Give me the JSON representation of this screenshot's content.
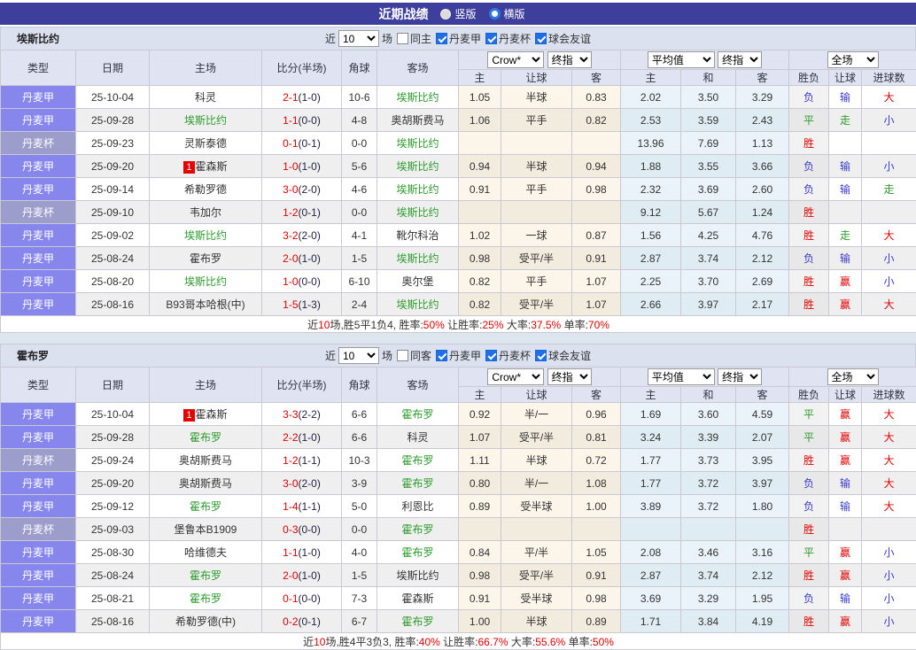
{
  "titlebar": {
    "title": "近期战绩",
    "vertical_label": "竖版",
    "horizontal_label": "横版",
    "vertical_checked": false,
    "horizontal_checked": true
  },
  "filters": {
    "near_label": "近",
    "count_value": "10",
    "matches_label": "场",
    "leagues": [
      "丹麦甲",
      "丹麦杯",
      "球会友谊"
    ]
  },
  "columns": {
    "type": "类型",
    "date": "日期",
    "home": "主场",
    "score": "比分(半场)",
    "corner": "角球",
    "away": "客场",
    "crow_select": "Crow*",
    "final_select": "终指",
    "avg_select": "平均值",
    "final2_select": "终指",
    "fulltime_select": "全场",
    "sub": {
      "home": "主",
      "handicap": "让球",
      "away": "客",
      "avg_home": "主",
      "draw": "和",
      "avg_away": "客",
      "wdl": "胜负",
      "hand_result": "让球",
      "goals": "进球数"
    }
  },
  "colors": {
    "topbar": "#3e3e9c",
    "league_cell": "#8686ec",
    "cup_cell": "#9d9dcb",
    "highlight_team": "#2d9b2d",
    "win_red": "#e00000",
    "lose_blue": "#3939cc",
    "draw_green": "#2d9b2d"
  },
  "result_colors": {
    "胜": "red",
    "平": "green",
    "负": "blue",
    "赢": "red",
    "走": "green",
    "输": "blue",
    "大": "red",
    "小": "blue"
  },
  "sections": [
    {
      "team": "埃斯比约",
      "same_label": "同主",
      "rows": [
        {
          "type": "丹麦甲",
          "cup": false,
          "date": "25-10-04",
          "home": "科灵",
          "home_hl": false,
          "score": "2-1",
          "half": "(1-0)",
          "corner": "10-6",
          "away": "埃斯比约",
          "away_hl": true,
          "crow": [
            "1.05",
            "半球",
            "0.83"
          ],
          "avg": [
            "2.02",
            "3.50",
            "3.29"
          ],
          "res": [
            "负",
            "输",
            "大"
          ]
        },
        {
          "type": "丹麦甲",
          "cup": false,
          "date": "25-09-28",
          "home": "埃斯比约",
          "home_hl": true,
          "score": "1-1",
          "half": "(0-0)",
          "corner": "4-8",
          "away": "奥胡斯费马",
          "away_hl": false,
          "crow": [
            "1.06",
            "平手",
            "0.82"
          ],
          "avg": [
            "2.53",
            "3.59",
            "2.43"
          ],
          "res": [
            "平",
            "走",
            "小"
          ]
        },
        {
          "type": "丹麦杯",
          "cup": true,
          "date": "25-09-23",
          "home": "灵斯泰德",
          "home_hl": false,
          "score": "0-1",
          "half": "(0-1)",
          "corner": "0-0",
          "away": "埃斯比约",
          "away_hl": true,
          "crow": [
            "",
            "",
            ""
          ],
          "avg": [
            "13.96",
            "7.69",
            "1.13"
          ],
          "res": [
            "胜",
            "",
            ""
          ]
        },
        {
          "type": "丹麦甲",
          "cup": false,
          "date": "25-09-20",
          "badge": "1",
          "home": "霍森斯",
          "home_hl": false,
          "score": "1-0",
          "half": "(1-0)",
          "corner": "5-6",
          "away": "埃斯比约",
          "away_hl": true,
          "crow": [
            "0.94",
            "半球",
            "0.94"
          ],
          "avg": [
            "1.88",
            "3.55",
            "3.66"
          ],
          "res": [
            "负",
            "输",
            "小"
          ]
        },
        {
          "type": "丹麦甲",
          "cup": false,
          "date": "25-09-14",
          "home": "希勒罗德",
          "home_hl": false,
          "score": "3-0",
          "half": "(2-0)",
          "corner": "4-6",
          "away": "埃斯比约",
          "away_hl": true,
          "crow": [
            "0.91",
            "平手",
            "0.98"
          ],
          "avg": [
            "2.32",
            "3.69",
            "2.60"
          ],
          "res": [
            "负",
            "输",
            "走"
          ]
        },
        {
          "type": "丹麦杯",
          "cup": true,
          "date": "25-09-10",
          "home": "韦加尔",
          "home_hl": false,
          "score": "1-2",
          "half": "(0-1)",
          "corner": "0-0",
          "away": "埃斯比约",
          "away_hl": true,
          "crow": [
            "",
            "",
            ""
          ],
          "avg": [
            "9.12",
            "5.67",
            "1.24"
          ],
          "res": [
            "胜",
            "",
            ""
          ]
        },
        {
          "type": "丹麦甲",
          "cup": false,
          "date": "25-09-02",
          "home": "埃斯比约",
          "home_hl": true,
          "score": "3-2",
          "half": "(2-0)",
          "corner": "4-1",
          "away": "靴尔科治",
          "away_hl": false,
          "crow": [
            "1.02",
            "一球",
            "0.87"
          ],
          "avg": [
            "1.56",
            "4.25",
            "4.76"
          ],
          "res": [
            "胜",
            "走",
            "大"
          ]
        },
        {
          "type": "丹麦甲",
          "cup": false,
          "date": "25-08-24",
          "home": "霍布罗",
          "home_hl": false,
          "score": "2-0",
          "half": "(1-0)",
          "corner": "1-5",
          "away": "埃斯比约",
          "away_hl": true,
          "crow": [
            "0.98",
            "受平/半",
            "0.91"
          ],
          "avg": [
            "2.87",
            "3.74",
            "2.12"
          ],
          "res": [
            "负",
            "输",
            "小"
          ]
        },
        {
          "type": "丹麦甲",
          "cup": false,
          "date": "25-08-20",
          "home": "埃斯比约",
          "home_hl": true,
          "score": "1-0",
          "half": "(0-0)",
          "corner": "6-10",
          "away": "奥尔堡",
          "away_hl": false,
          "crow": [
            "0.82",
            "平手",
            "1.07"
          ],
          "avg": [
            "2.25",
            "3.70",
            "2.69"
          ],
          "res": [
            "胜",
            "赢",
            "小"
          ]
        },
        {
          "type": "丹麦甲",
          "cup": false,
          "date": "25-08-16",
          "home": "B93哥本哈根(中)",
          "home_hl": false,
          "score": "1-5",
          "half": "(1-3)",
          "corner": "2-4",
          "away": "埃斯比约",
          "away_hl": true,
          "crow": [
            "0.82",
            "受平/半",
            "1.07"
          ],
          "avg": [
            "2.66",
            "3.97",
            "2.17"
          ],
          "res": [
            "胜",
            "赢",
            "大"
          ]
        }
      ],
      "summary": [
        {
          "t": "近"
        },
        {
          "t": "10",
          "red": true
        },
        {
          "t": "场,胜5平1负4, 胜率:"
        },
        {
          "t": "50%",
          "red": true
        },
        {
          "t": " 让胜率:"
        },
        {
          "t": "25%",
          "red": true
        },
        {
          "t": " 大率:"
        },
        {
          "t": "37.5%",
          "red": true
        },
        {
          "t": " 单率:"
        },
        {
          "t": "70%",
          "red": true
        }
      ]
    },
    {
      "team": "霍布罗",
      "same_label": "同客",
      "rows": [
        {
          "type": "丹麦甲",
          "cup": false,
          "date": "25-10-04",
          "badge": "1",
          "home": "霍森斯",
          "home_hl": false,
          "score": "3-3",
          "half": "(2-2)",
          "corner": "6-6",
          "away": "霍布罗",
          "away_hl": true,
          "crow": [
            "0.92",
            "半/一",
            "0.96"
          ],
          "avg": [
            "1.69",
            "3.60",
            "4.59"
          ],
          "res": [
            "平",
            "赢",
            "大"
          ]
        },
        {
          "type": "丹麦甲",
          "cup": false,
          "date": "25-09-28",
          "home": "霍布罗",
          "home_hl": true,
          "score": "2-2",
          "half": "(1-0)",
          "corner": "6-6",
          "away": "科灵",
          "away_hl": false,
          "crow": [
            "1.07",
            "受平/半",
            "0.81"
          ],
          "avg": [
            "3.24",
            "3.39",
            "2.07"
          ],
          "res": [
            "平",
            "赢",
            "大"
          ]
        },
        {
          "type": "丹麦杯",
          "cup": true,
          "date": "25-09-24",
          "home": "奥胡斯费马",
          "home_hl": false,
          "score": "1-2",
          "half": "(1-1)",
          "corner": "10-3",
          "away": "霍布罗",
          "away_hl": true,
          "crow": [
            "1.11",
            "半球",
            "0.72"
          ],
          "avg": [
            "1.77",
            "3.73",
            "3.95"
          ],
          "res": [
            "胜",
            "赢",
            "大"
          ]
        },
        {
          "type": "丹麦甲",
          "cup": false,
          "date": "25-09-20",
          "home": "奥胡斯费马",
          "home_hl": false,
          "score": "3-0",
          "half": "(2-0)",
          "corner": "3-9",
          "away": "霍布罗",
          "away_hl": true,
          "crow": [
            "0.80",
            "半/一",
            "1.08"
          ],
          "avg": [
            "1.77",
            "3.72",
            "3.97"
          ],
          "res": [
            "负",
            "输",
            "大"
          ]
        },
        {
          "type": "丹麦甲",
          "cup": false,
          "date": "25-09-12",
          "home": "霍布罗",
          "home_hl": true,
          "score": "1-4",
          "half": "(1-1)",
          "corner": "5-0",
          "away": "利恩比",
          "away_hl": false,
          "crow": [
            "0.89",
            "受半球",
            "1.00"
          ],
          "avg": [
            "3.89",
            "3.72",
            "1.80"
          ],
          "res": [
            "负",
            "输",
            "大"
          ]
        },
        {
          "type": "丹麦杯",
          "cup": true,
          "date": "25-09-03",
          "home": "堡鲁本B1909",
          "home_hl": false,
          "score": "0-3",
          "half": "(0-0)",
          "corner": "0-0",
          "away": "霍布罗",
          "away_hl": true,
          "crow": [
            "",
            "",
            ""
          ],
          "avg": [
            "",
            "",
            ""
          ],
          "res": [
            "胜",
            "",
            ""
          ]
        },
        {
          "type": "丹麦甲",
          "cup": false,
          "date": "25-08-30",
          "home": "哈维德夫",
          "home_hl": false,
          "score": "1-1",
          "half": "(1-0)",
          "corner": "4-0",
          "away": "霍布罗",
          "away_hl": true,
          "crow": [
            "0.84",
            "平/半",
            "1.05"
          ],
          "avg": [
            "2.08",
            "3.46",
            "3.16"
          ],
          "res": [
            "平",
            "赢",
            "小"
          ]
        },
        {
          "type": "丹麦甲",
          "cup": false,
          "date": "25-08-24",
          "home": "霍布罗",
          "home_hl": true,
          "score": "2-0",
          "half": "(1-0)",
          "corner": "1-5",
          "away": "埃斯比约",
          "away_hl": false,
          "crow": [
            "0.98",
            "受平/半",
            "0.91"
          ],
          "avg": [
            "2.87",
            "3.74",
            "2.12"
          ],
          "res": [
            "胜",
            "赢",
            "小"
          ]
        },
        {
          "type": "丹麦甲",
          "cup": false,
          "date": "25-08-21",
          "home": "霍布罗",
          "home_hl": true,
          "score": "0-1",
          "half": "(0-0)",
          "corner": "7-3",
          "away": "霍森斯",
          "away_hl": false,
          "crow": [
            "0.91",
            "受半球",
            "0.98"
          ],
          "avg": [
            "3.69",
            "3.29",
            "1.95"
          ],
          "res": [
            "负",
            "输",
            "小"
          ]
        },
        {
          "type": "丹麦甲",
          "cup": false,
          "date": "25-08-16",
          "home": "希勒罗德(中)",
          "home_hl": false,
          "score": "0-2",
          "half": "(0-1)",
          "corner": "6-7",
          "away": "霍布罗",
          "away_hl": true,
          "crow": [
            "1.00",
            "半球",
            "0.89"
          ],
          "avg": [
            "1.71",
            "3.84",
            "4.19"
          ],
          "res": [
            "胜",
            "赢",
            "小"
          ]
        }
      ],
      "summary": [
        {
          "t": "近"
        },
        {
          "t": "10",
          "red": true
        },
        {
          "t": "场,胜4平3负3, 胜率:"
        },
        {
          "t": "40%",
          "red": true
        },
        {
          "t": " 让胜率:"
        },
        {
          "t": "66.7%",
          "red": true
        },
        {
          "t": " 大率:"
        },
        {
          "t": "55.6%",
          "red": true
        },
        {
          "t": " 单率:"
        },
        {
          "t": "50%",
          "red": true
        }
      ]
    }
  ]
}
